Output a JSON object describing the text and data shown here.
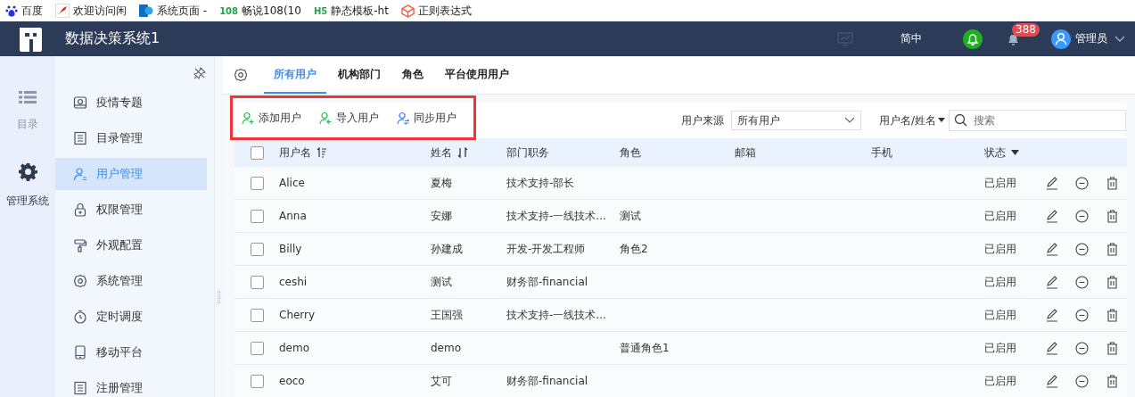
{
  "bookmarks": [
    {
      "kind": "paw",
      "label": "百度"
    },
    {
      "kind": "bird",
      "label": "欢迎访问闲"
    },
    {
      "kind": "s",
      "label": "系统页面 -"
    },
    {
      "kind": "text",
      "icon_text": "108",
      "label": "畅说108(10"
    },
    {
      "kind": "text",
      "icon_text": "H5",
      "label": "静态模板-ht"
    },
    {
      "kind": "cube",
      "label": "正则表达式"
    }
  ],
  "header": {
    "title": "数据决策系统1",
    "language": "简中",
    "notification_count": "388",
    "user": "管理员"
  },
  "rail": [
    {
      "kind": "list",
      "label": "目录",
      "selected": false
    },
    {
      "kind": "gear",
      "label": "管理系统",
      "selected": true
    }
  ],
  "sidebar": {
    "items": [
      {
        "kind": "monitor",
        "label": "疫情专题",
        "selected": false
      },
      {
        "kind": "list",
        "label": "目录管理",
        "selected": false
      },
      {
        "kind": "user",
        "label": "用户管理",
        "selected": true
      },
      {
        "kind": "lock",
        "label": "权限管理",
        "selected": false
      },
      {
        "kind": "roller",
        "label": "外观配置",
        "selected": false
      },
      {
        "kind": "gear",
        "label": "系统管理",
        "selected": false
      },
      {
        "kind": "timer",
        "label": "定时调度",
        "selected": false
      },
      {
        "kind": "phone",
        "label": "移动平台",
        "selected": false
      },
      {
        "kind": "list",
        "label": "注册管理",
        "selected": false
      }
    ]
  },
  "tabs": [
    {
      "label": "所有用户",
      "selected": true
    },
    {
      "label": "机构部门",
      "selected": false
    },
    {
      "label": "角色",
      "selected": false
    },
    {
      "label": "平台使用用户",
      "selected": false
    }
  ],
  "toolbar": {
    "highlighted": true,
    "buttons": [
      {
        "kind": "add",
        "label": "添加用户"
      },
      {
        "kind": "import",
        "label": "导入用户"
      },
      {
        "kind": "sync",
        "label": "同步用户"
      }
    ],
    "source_label": "用户来源",
    "source_value": "所有用户",
    "search_scope": "用户名/姓名",
    "search_placeholder": "搜索"
  },
  "table": {
    "all_checked": false,
    "columns": [
      {
        "label": "用户名",
        "kind": "sort-asc"
      },
      {
        "label": "姓名",
        "kind": "sort"
      },
      {
        "label": "部门职务",
        "kind": "plain"
      },
      {
        "label": "角色",
        "kind": "plain"
      },
      {
        "label": "邮箱",
        "kind": "plain"
      },
      {
        "label": "手机",
        "kind": "plain"
      },
      {
        "label": "状态",
        "kind": "filter"
      }
    ],
    "rows": [
      {
        "checked": false,
        "cells": [
          "Alice",
          "夏梅",
          "技术支持-部长",
          "",
          "",
          "",
          "已启用"
        ]
      },
      {
        "checked": false,
        "cells": [
          "Anna",
          "安娜",
          "技术支持-一线技术...",
          "测试",
          "",
          "",
          "已启用"
        ]
      },
      {
        "checked": false,
        "cells": [
          "Billy",
          "孙建成",
          "开发-开发工程师",
          "角色2",
          "",
          "",
          "已启用"
        ]
      },
      {
        "checked": false,
        "cells": [
          "ceshi",
          "测试",
          "财务部-financial",
          "",
          "",
          "",
          "已启用"
        ]
      },
      {
        "checked": false,
        "cells": [
          "Cherry",
          "王国强",
          "技术支持-一线技术...",
          "",
          "",
          "",
          "已启用"
        ]
      },
      {
        "checked": false,
        "cells": [
          "demo",
          "demo",
          "",
          "普通角色1",
          "",
          "",
          "已启用"
        ]
      },
      {
        "checked": false,
        "cells": [
          "eoco",
          "艾可",
          "财务部-financial",
          "",
          "",
          "",
          "已启用"
        ]
      }
    ]
  }
}
